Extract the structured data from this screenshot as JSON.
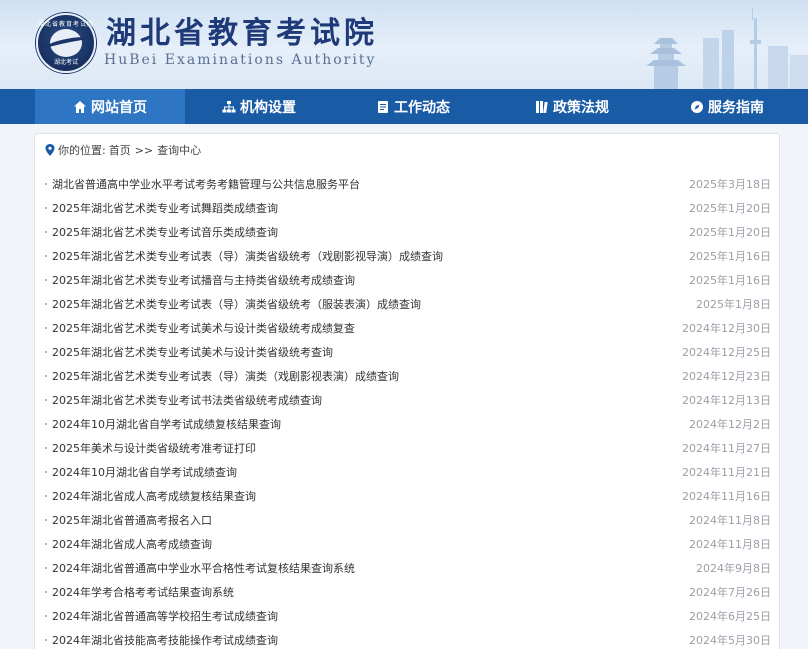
{
  "header": {
    "title": "湖北省教育考试院",
    "subtitle": "HuBei Examinations Authority",
    "emblem_top": "湖北省教育考试院",
    "emblem_bottom": "湖北考试"
  },
  "nav": {
    "items": [
      {
        "label": "网站首页",
        "icon": "home-icon",
        "active": true
      },
      {
        "label": "机构设置",
        "icon": "org-chart-icon",
        "active": false
      },
      {
        "label": "工作动态",
        "icon": "document-icon",
        "active": false
      },
      {
        "label": "政策法规",
        "icon": "book-icon",
        "active": false
      },
      {
        "label": "服务指南",
        "icon": "compass-icon",
        "active": false
      }
    ]
  },
  "breadcrumb": {
    "prefix": "你的位置:",
    "home": "首页",
    "sep": ">>",
    "current": "查询中心"
  },
  "list": [
    {
      "title": "湖北省普通高中学业水平考试考务考籍管理与公共信息服务平台",
      "date": "2025年3月18日"
    },
    {
      "title": "2025年湖北省艺术类专业考试舞蹈类成绩查询",
      "date": "2025年1月20日"
    },
    {
      "title": "2025年湖北省艺术类专业考试音乐类成绩查询",
      "date": "2025年1月20日"
    },
    {
      "title": "2025年湖北省艺术类专业考试表（导）演类省级统考（戏剧影视导演）成绩查询",
      "date": "2025年1月16日"
    },
    {
      "title": "2025年湖北省艺术类专业考试播音与主持类省级统考成绩查询",
      "date": "2025年1月16日"
    },
    {
      "title": "2025年湖北省艺术类专业考试表（导）演类省级统考（服装表演）成绩查询",
      "date": "2025年1月8日"
    },
    {
      "title": "2025年湖北省艺术类专业考试美术与设计类省级统考成绩复查",
      "date": "2024年12月30日"
    },
    {
      "title": "2025年湖北省艺术类专业考试美术与设计类省级统考查询",
      "date": "2024年12月25日"
    },
    {
      "title": "2025年湖北省艺术类专业考试表（导）演类（戏剧影视表演）成绩查询",
      "date": "2024年12月23日"
    },
    {
      "title": "2025年湖北省艺术类专业考试书法类省级统考成绩查询",
      "date": "2024年12月13日"
    },
    {
      "title": "2024年10月湖北省自学考试成绩复核结果查询",
      "date": "2024年12月2日"
    },
    {
      "title": "2025年美术与设计类省级统考准考证打印",
      "date": "2024年11月27日"
    },
    {
      "title": "2024年10月湖北省自学考试成绩查询",
      "date": "2024年11月21日"
    },
    {
      "title": "2024年湖北省成人高考成绩复核结果查询",
      "date": "2024年11月16日"
    },
    {
      "title": "2025年湖北省普通高考报名入口",
      "date": "2024年11月8日"
    },
    {
      "title": "2024年湖北省成人高考成绩查询",
      "date": "2024年11月8日"
    },
    {
      "title": "2024年湖北省普通高中学业水平合格性考试复核结果查询系统",
      "date": "2024年9月8日"
    },
    {
      "title": "2024年学考合格考考试结果查询系统",
      "date": "2024年7月26日"
    },
    {
      "title": "2024年湖北省普通高等学校招生考试成绩查询",
      "date": "2024年6月25日"
    },
    {
      "title": "2024年湖北省技能高考技能操作考试成绩查询",
      "date": "2024年5月30日"
    }
  ],
  "colors": {
    "nav_bg": "#1a5ba6",
    "nav_active": "#2e76c4",
    "title_blue": "#1e3a78",
    "date_gray": "#9aa0a8"
  }
}
